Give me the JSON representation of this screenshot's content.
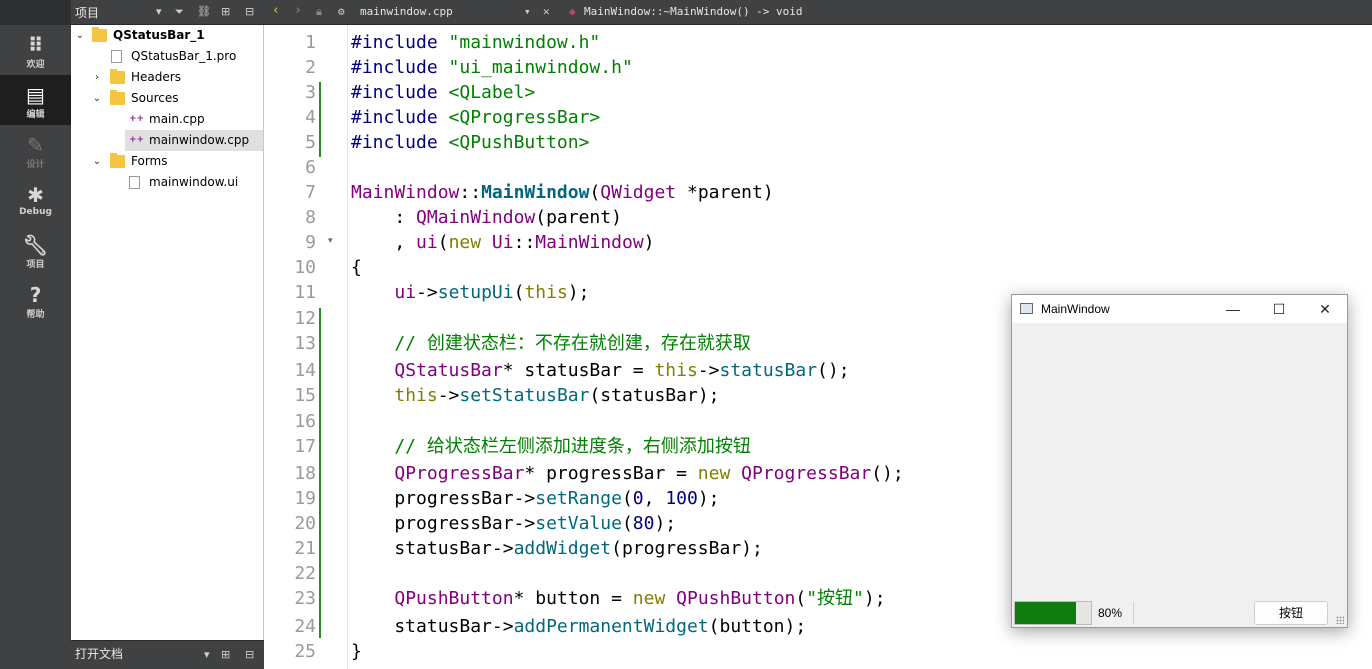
{
  "project_pane": {
    "title": "项目",
    "open_docs_title": "打开文档"
  },
  "editor_toolbar": {
    "file_name": "mainwindow.cpp",
    "function_name": "MainWindow::~MainWindow() -> void"
  },
  "modes": [
    {
      "label": "欢迎",
      "icon": "grid-icon"
    },
    {
      "label": "编辑",
      "icon": "document-icon"
    },
    {
      "label": "设计",
      "icon": "pencil-icon"
    },
    {
      "label": "Debug",
      "icon": "bug-icon"
    },
    {
      "label": "项目",
      "icon": "wrench-icon"
    },
    {
      "label": "帮助",
      "icon": "help-icon"
    }
  ],
  "tree": {
    "project": "QStatusBar_1",
    "pro_file": "QStatusBar_1.pro",
    "headers": "Headers",
    "sources": "Sources",
    "main_cpp": "main.cpp",
    "mainwindow_cpp": "mainwindow.cpp",
    "forms": "Forms",
    "mainwindow_ui": "mainwindow.ui"
  },
  "line_numbers": [
    "1",
    "2",
    "3",
    "4",
    "5",
    "6",
    "7",
    "8",
    "9",
    "10",
    "11",
    "12",
    "13",
    "14",
    "15",
    "16",
    "17",
    "18",
    "19",
    "20",
    "21",
    "22",
    "23",
    "24",
    "25"
  ],
  "code": {
    "l1": [
      "#include ",
      "\"mainwindow.h\""
    ],
    "l2": [
      "#include ",
      "\"ui_mainwindow.h\""
    ],
    "l3": [
      "#include ",
      "<QLabel>"
    ],
    "l4": [
      "#include ",
      "<QProgressBar>"
    ],
    "l5": [
      "#include ",
      "<QPushButton>"
    ],
    "l7": [
      "MainWindow",
      "::",
      "MainWindow",
      "(",
      "QWidget",
      " *parent)"
    ],
    "l8": [
      "    : ",
      "QMainWindow",
      "(parent)"
    ],
    "l9": [
      "    , ",
      "ui",
      "(",
      "new",
      " ",
      "Ui",
      "::",
      "MainWindow",
      ")"
    ],
    "l10": "{",
    "l11": [
      "    ",
      "ui",
      "->",
      "setupUi",
      "(",
      "this",
      ");"
    ],
    "l13": "    // 创建状态栏：不存在就创建，存在就获取",
    "l14": [
      "    ",
      "QStatusBar",
      "* statusBar = ",
      "this",
      "->",
      "statusBar",
      "();"
    ],
    "l15": [
      "    ",
      "this",
      "->",
      "setStatusBar",
      "(statusBar);"
    ],
    "l17": "    // 给状态栏左侧添加进度条，右侧添加按钮",
    "l18": [
      "    ",
      "QProgressBar",
      "* progressBar = ",
      "new",
      " ",
      "QProgressBar",
      "();"
    ],
    "l19": [
      "    progressBar->",
      "setRange",
      "(",
      "0",
      ", ",
      "100",
      ");"
    ],
    "l20": [
      "    progressBar->",
      "setValue",
      "(",
      "80",
      ");"
    ],
    "l21": [
      "    statusBar->",
      "addWidget",
      "(progressBar);"
    ],
    "l23": [
      "    ",
      "QPushButton",
      "* button = ",
      "new",
      " ",
      "QPushButton",
      "(",
      "\"按钮\"",
      ");"
    ],
    "l24": [
      "    statusBar->",
      "addPermanentWidget",
      "(button);"
    ],
    "l25": "}"
  },
  "main_window": {
    "title": "MainWindow",
    "minimize": "—",
    "maximize": "☐",
    "close": "✕",
    "progress_value": 80,
    "progress_text": "80%",
    "button_label": "按钮"
  }
}
